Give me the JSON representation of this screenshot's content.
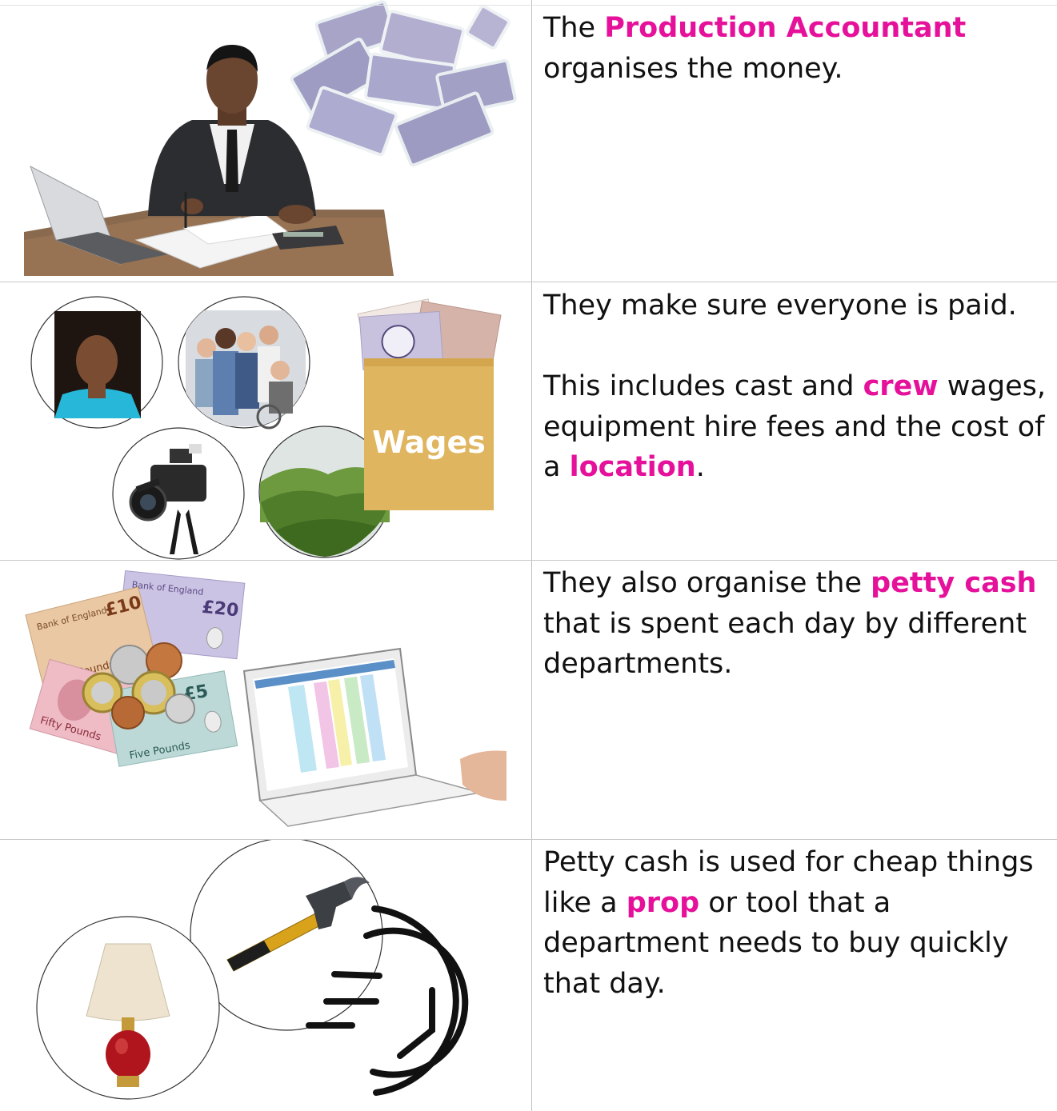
{
  "colors": {
    "highlight": "#e6119b",
    "grid": "#bfbfbf",
    "text": "#111111"
  },
  "rows": [
    {
      "image_icons": [
        "accountant-at-desk",
        "banknote-bundles"
      ],
      "paragraphs": [
        {
          "t1": "The ",
          "h1": "Production Accountant",
          "t2": " organises the money."
        }
      ]
    },
    {
      "image_icons": [
        "actress-portrait",
        "crew-group",
        "video-camera",
        "green-hills-location",
        "wages-envelope"
      ],
      "envelope_label": "Wages",
      "paragraphs": [
        {
          "t1": "They make sure everyone is paid."
        },
        {
          "t1": "This includes cast and ",
          "h1": "crew",
          "t2": " wages, equipment hire fees and the cost of a ",
          "h2": "location",
          "t3": "."
        }
      ]
    },
    {
      "image_icons": [
        "banknotes-and-coins",
        "laptop-spreadsheet"
      ],
      "notes": {
        "ten": "£10",
        "twenty": "£20",
        "five": "£5",
        "bank": "Bank of England",
        "ten_words": "Ten Pounds",
        "fifty_words": "Fifty Pounds",
        "five_words": "Five Pounds"
      },
      "paragraphs": [
        {
          "t1": "They also organise the ",
          "h1": "petty cash",
          "t2": " that is spent each day by different departments."
        }
      ]
    },
    {
      "image_icons": [
        "table-lamp",
        "hammer",
        "fast-clock"
      ],
      "paragraphs": [
        {
          "t1": "Petty cash is used for cheap things like a ",
          "h1": "prop",
          "t2": " or tool that a department needs to buy quickly that day."
        }
      ]
    }
  ]
}
